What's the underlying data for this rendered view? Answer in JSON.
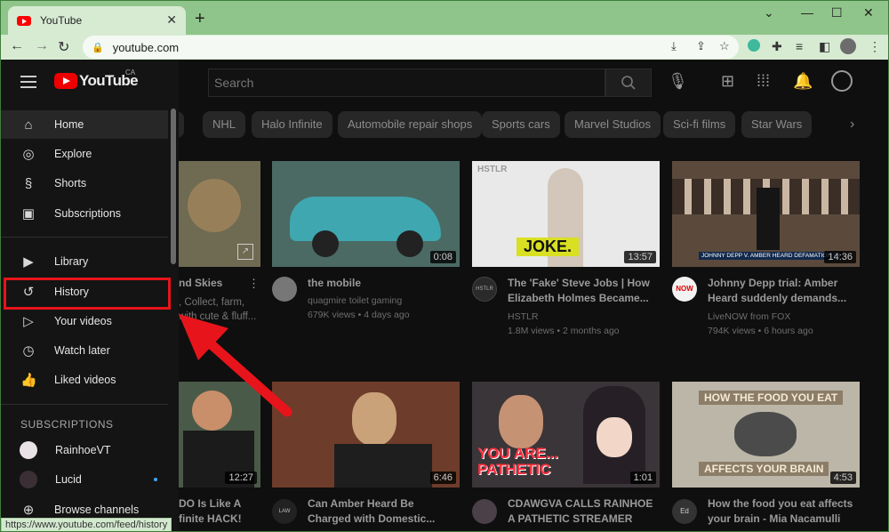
{
  "browser": {
    "tab_title": "YouTube",
    "tab_close": "✕",
    "new_tab": "+",
    "url": "youtube.com",
    "window_controls": [
      "⌄",
      "—",
      "☐",
      "✕"
    ],
    "status_url": "https://www.youtube.com/feed/history"
  },
  "youtube": {
    "logo_text": "YouTube",
    "region": "CA",
    "search_placeholder": "Search",
    "chips": [
      "p",
      "NHL",
      "Halo Infinite",
      "Automobile repair shops",
      "Sports cars",
      "Marvel Studios",
      "Sci-fi films",
      "Star Wars"
    ]
  },
  "sidebar": {
    "items": [
      {
        "label": "Home",
        "icon": "⌂"
      },
      {
        "label": "Explore",
        "icon": "◎"
      },
      {
        "label": "Shorts",
        "icon": "§"
      },
      {
        "label": "Subscriptions",
        "icon": "▣"
      },
      {
        "label": "Library",
        "icon": "▶"
      },
      {
        "label": "History",
        "icon": "↺"
      },
      {
        "label": "Your videos",
        "icon": "▷"
      },
      {
        "label": "Watch later",
        "icon": "◷"
      },
      {
        "label": "Liked videos",
        "icon": "👍"
      }
    ],
    "subscriptions_header": "SUBSCRIPTIONS",
    "subscriptions": [
      {
        "label": "RainhoeVT"
      },
      {
        "label": "Lucid"
      },
      {
        "label": "Browse channels",
        "icon": "⊕"
      }
    ]
  },
  "videos": [
    {
      "title_lines": [
        "nd Skies",
        ""
      ],
      "meta": [
        ", Collect, farm,",
        "with cute & fluff..."
      ],
      "duration": "",
      "thumb_color": "#6f6a52"
    },
    {
      "title_lines": [
        "the mobile",
        ""
      ],
      "meta": [
        "quagmire toilet gaming",
        "679K views • 4 days ago"
      ],
      "duration": "0:08",
      "thumb_color": "#4b6a64"
    },
    {
      "title_lines": [
        "The 'Fake' Steve Jobs | How",
        "Elizabeth Holmes Became..."
      ],
      "meta": [
        "HSTLR",
        "1.8M views • 2 months ago"
      ],
      "duration": "13:57",
      "thumb_color": "#e9e9e9",
      "overlay_label": "HSTLR",
      "overlay_text": "JOKE."
    },
    {
      "title_lines": [
        "Johnny Depp trial: Amber",
        "Heard suddenly demands..."
      ],
      "meta": [
        "LiveNOW from FOX",
        "794K views • 6 hours ago"
      ],
      "duration": "14:36",
      "thumb_color": "#5b4a3c",
      "caption": "JOHNNY DEPP V. AMBER HEARD DEFAMATION TR"
    },
    {
      "title_lines": [
        "DO Is Like A",
        "finite HACK!"
      ],
      "meta": [
        "",
        ""
      ],
      "duration": "12:27",
      "thumb_color": "#4a5a48"
    },
    {
      "title_lines": [
        "Can Amber Heard Be",
        "Charged with Domestic..."
      ],
      "meta": [
        "",
        ""
      ],
      "duration": "6:46",
      "thumb_color": "#6e3c2a"
    },
    {
      "title_lines": [
        "CDAWGVA CALLS RAINHOE",
        "A PATHETIC STREAMER"
      ],
      "meta": [
        "",
        ""
      ],
      "duration": "1:01",
      "thumb_color": "#3a3538",
      "overlay_text": "YOU ARE... PATHETIC"
    },
    {
      "title_lines": [
        "How the food you eat affects",
        "your brain - Mia Nacamulli"
      ],
      "meta": [
        "",
        ""
      ],
      "duration": "4:53",
      "thumb_color": "#bcb6a8",
      "overlay_top": "HOW THE FOOD YOU EAT",
      "overlay_bottom": "AFFECTS YOUR BRAIN"
    }
  ],
  "colors": {
    "highlight": "#e8141b",
    "arrow": "#e8141b",
    "youtube_red": "#ff0000",
    "chrome_green": "#8fc58a"
  }
}
